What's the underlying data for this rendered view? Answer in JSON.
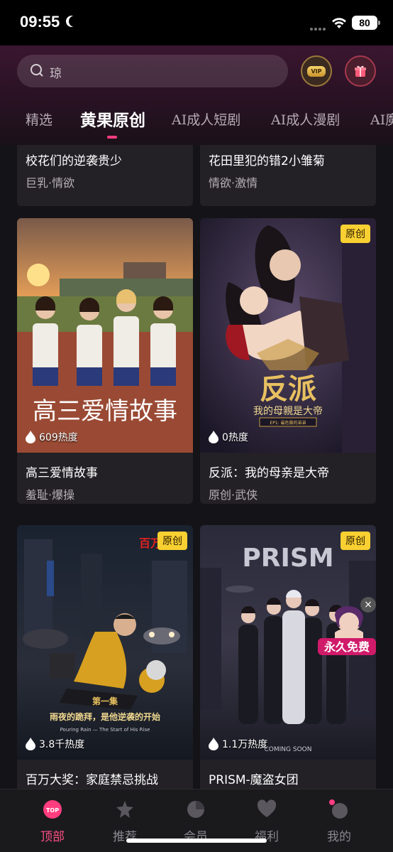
{
  "status": {
    "time": "09:55",
    "battery": "80"
  },
  "search": {
    "placeholder": "琼"
  },
  "header": {
    "vip_label": "VIP"
  },
  "tabs": [
    "精选",
    "黄果原创",
    "AI成人短剧",
    "AI成人漫剧",
    "AI魔"
  ],
  "active_tab": "黄果原创",
  "cards": [
    {
      "title": "校花们的逆袭贵少",
      "tags": "巨乳·情欲"
    },
    {
      "title": "花田里犯的错2小雏菊",
      "tags": "情欲·激情"
    },
    {
      "title": "高三爱情故事",
      "tags": "羞耻·爆操",
      "heat": "609热度",
      "cover_text": "高三爱情故事"
    },
    {
      "title": "反派：我的母亲是大帝",
      "tags": "原创·武侠",
      "heat": "0热度",
      "badge": "原创",
      "cover_text": "反派",
      "cover_subtitle": "我的母親是大帝",
      "cover_ep": "EP1: 最危險的弟弟"
    },
    {
      "title": "百万大奖：家庭禁忌挑战",
      "heat": "3.8千热度",
      "badge": "原创",
      "cover_tag": "百万",
      "cover_ep_title": "第一集",
      "cover_caption": "雨夜的跪拜，是他逆袭的开始",
      "cover_caption_en": "Pouring Rain — The Start of His Rise"
    },
    {
      "title": "PRISM-魔盗女团",
      "heat": "1.1万热度",
      "badge": "原创",
      "cover_text": "PRISM",
      "cover_sub": "COMING SOON"
    }
  ],
  "float_ad": {
    "text": "永久免费",
    "close": "×"
  },
  "nav": [
    {
      "label": "顶部",
      "icon_text": "TOP"
    },
    {
      "label": "推荐"
    },
    {
      "label": "会员"
    },
    {
      "label": "福利"
    },
    {
      "label": "我的"
    }
  ],
  "colors": {
    "accent": "#ff4f84",
    "badge": "#f8d031",
    "background": "#141317"
  }
}
